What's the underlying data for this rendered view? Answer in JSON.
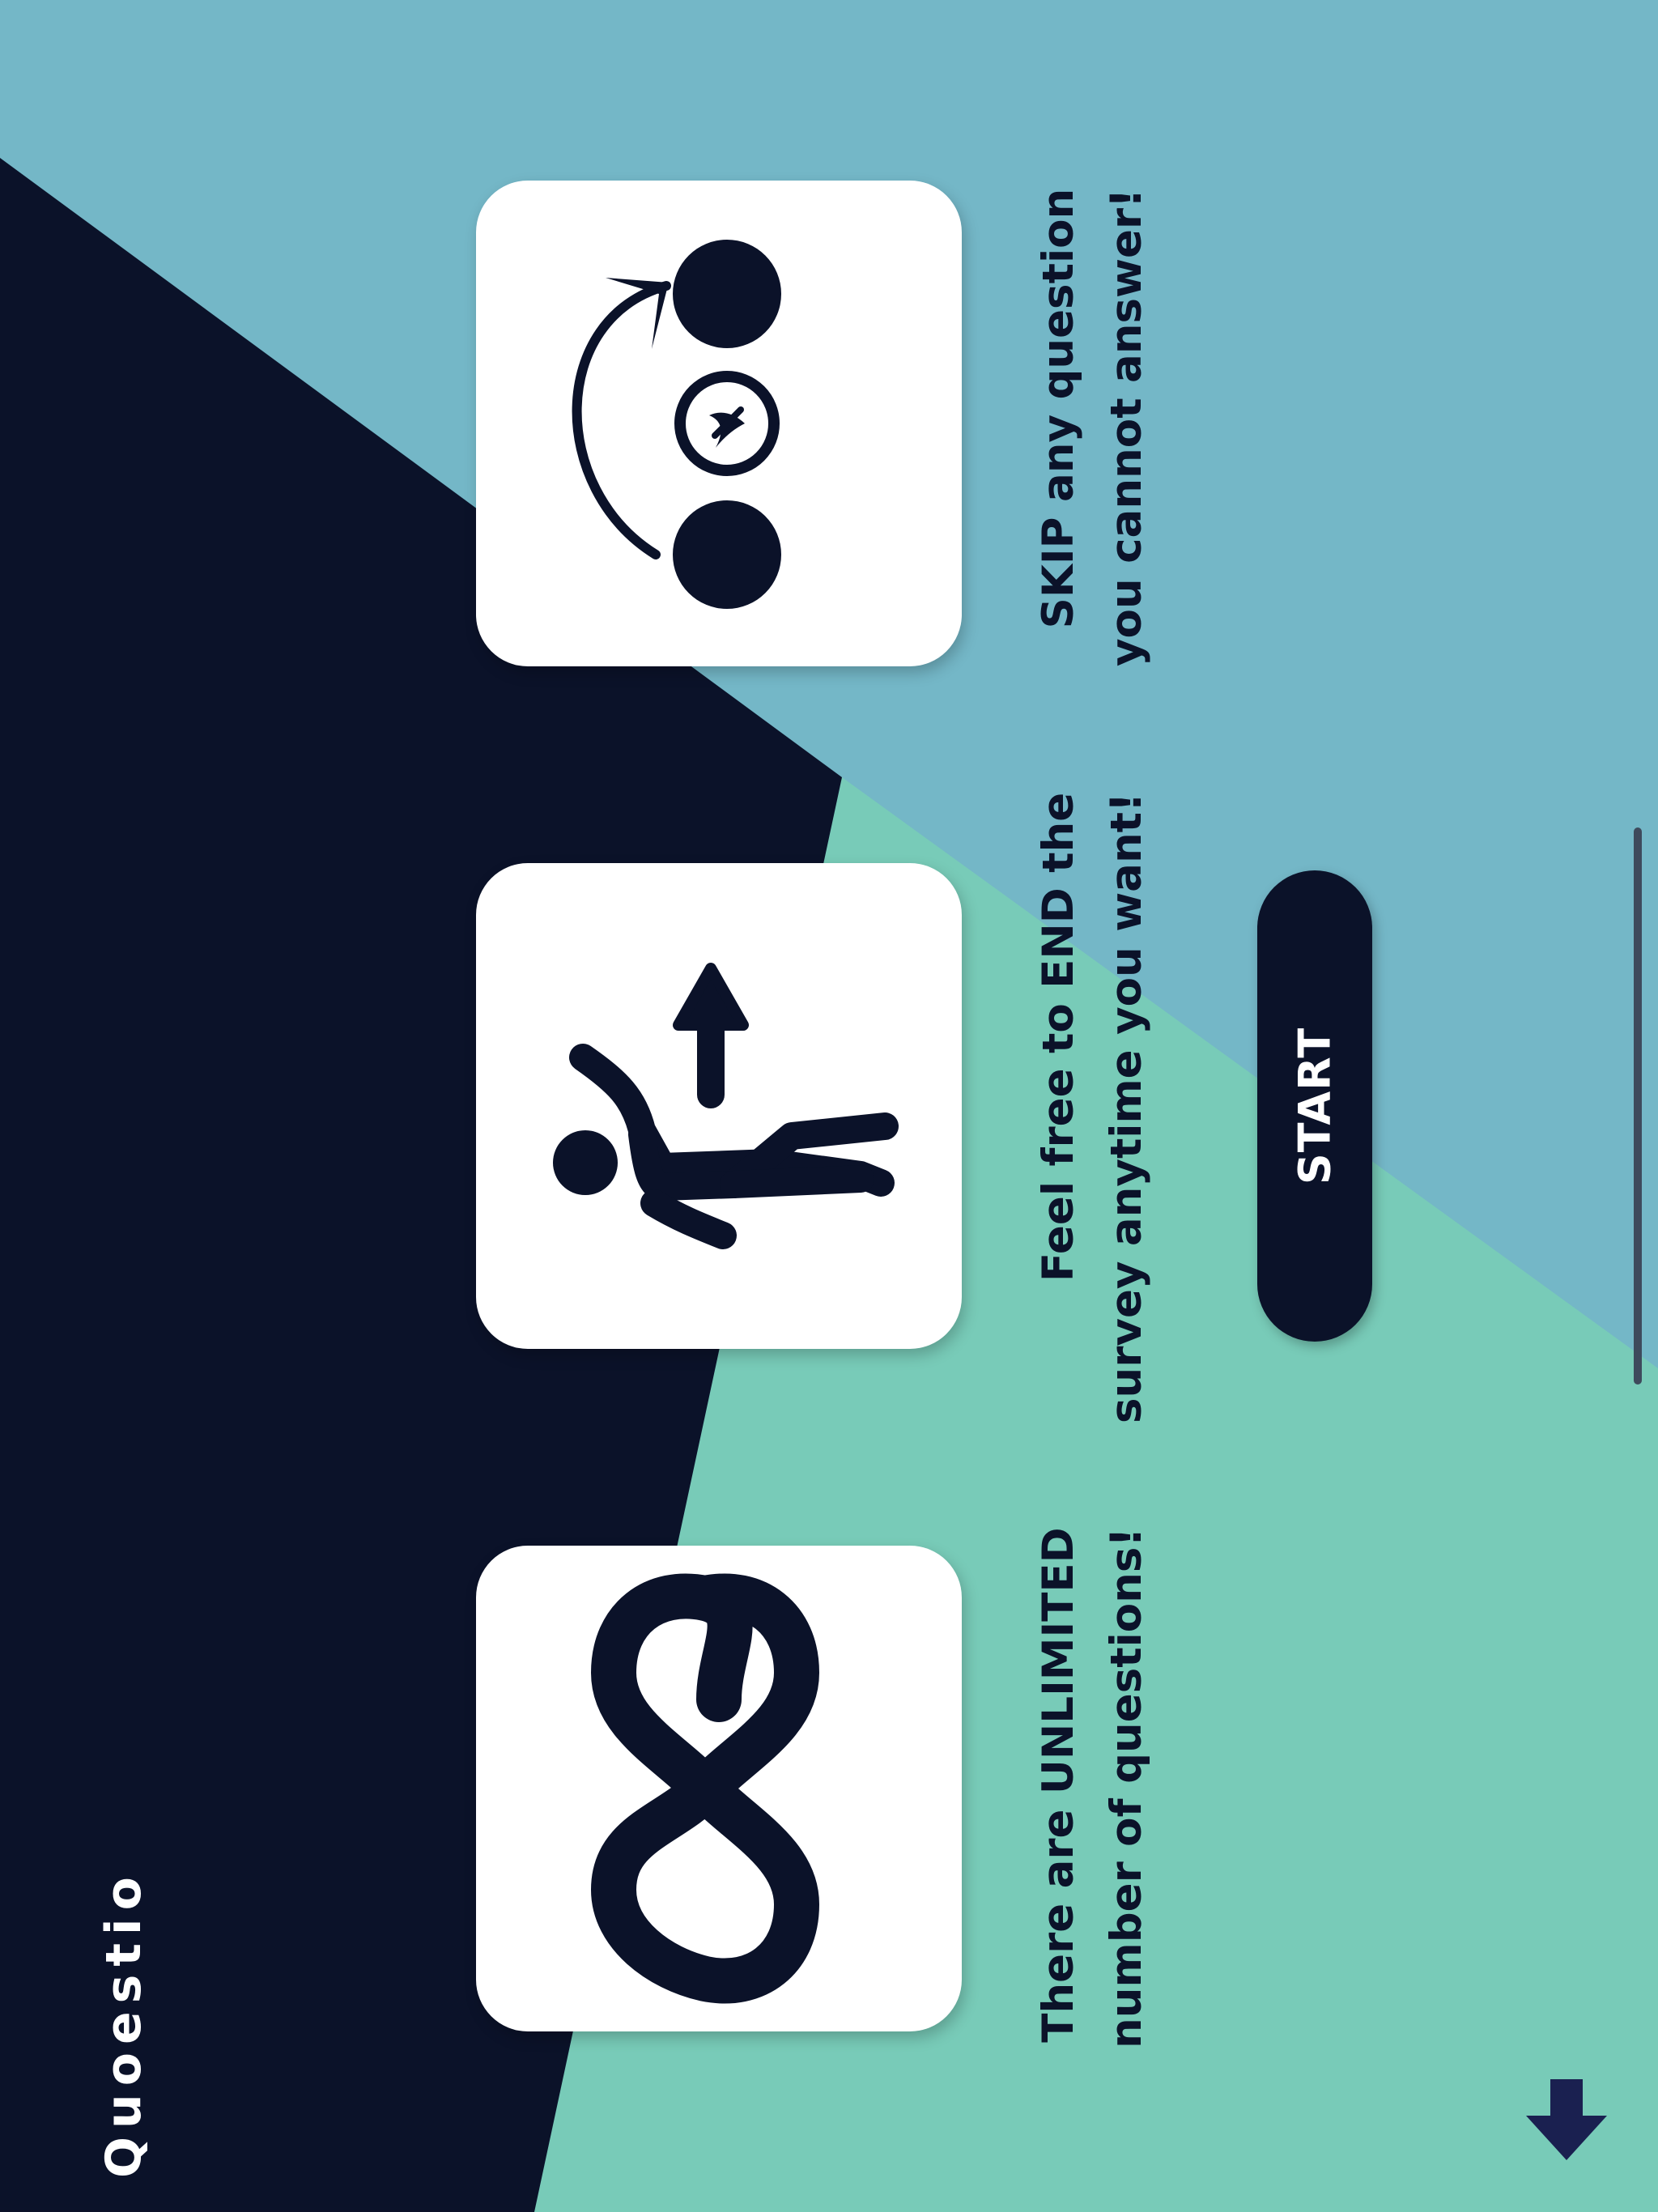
{
  "colors": {
    "sky": "#74b7c7",
    "mint": "#78cbb8",
    "navy": "#0b1229",
    "arrow": "#1a2050"
  },
  "cards": [
    {
      "icon": "skip-icon",
      "lines": [
        "SKIP any question",
        "you cannot answer!"
      ]
    },
    {
      "icon": "exit-person-icon",
      "lines": [
        "Feel free to END the",
        "survey anytime you want!"
      ]
    },
    {
      "icon": "infinity-icon",
      "lines": [
        "There are UNLIMITED",
        "number of questions!"
      ]
    }
  ],
  "start_button": {
    "label": "START"
  },
  "logo": {
    "text": "Quoestio"
  },
  "scroll_icon": "down-arrow-icon"
}
